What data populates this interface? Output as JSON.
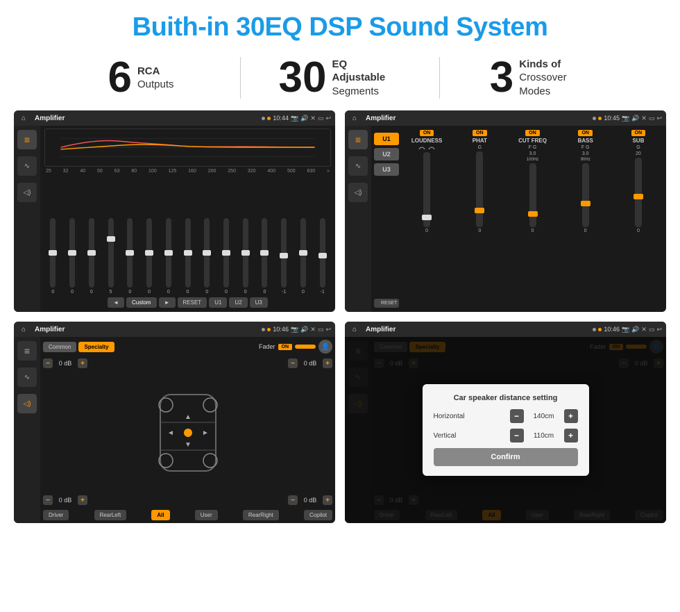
{
  "page": {
    "title": "Buith-in 30EQ DSP Sound System"
  },
  "stats": [
    {
      "number": "6",
      "label_main": "RCA",
      "label_sub": "Outputs"
    },
    {
      "number": "30",
      "label_main": "EQ Adjustable",
      "label_sub": "Segments"
    },
    {
      "number": "3",
      "label_main": "Kinds of",
      "label_sub": "Crossover Modes"
    }
  ],
  "screens": [
    {
      "id": "eq-screen",
      "time": "10:44",
      "title": "Amplifier",
      "eq_labels": [
        "25",
        "32",
        "40",
        "50",
        "63",
        "80",
        "100",
        "125",
        "160",
        "200",
        "250",
        "320",
        "400",
        "500",
        "630"
      ],
      "eq_values": [
        "0",
        "0",
        "0",
        "5",
        "0",
        "0",
        "0",
        "0",
        "0",
        "0",
        "0",
        "0",
        "-1",
        "0",
        "-1"
      ],
      "presets": [
        "Custom",
        "RESET",
        "U1",
        "U2",
        "U3"
      ]
    },
    {
      "id": "crossover-screen",
      "time": "10:45",
      "title": "Amplifier",
      "channels": [
        "U1",
        "U2",
        "U3"
      ],
      "controls": [
        "LOUDNESS",
        "PHAT",
        "CUT FREQ",
        "BASS",
        "SUB"
      ]
    },
    {
      "id": "fader-screen",
      "time": "10:46",
      "title": "Amplifier",
      "tabs": [
        "Common",
        "Specialty"
      ],
      "fader_label": "Fader",
      "buttons": [
        "Driver",
        "RearLeft",
        "All",
        "User",
        "RearRight",
        "Copilot"
      ],
      "db_values": [
        "0 dB",
        "0 dB",
        "0 dB",
        "0 dB"
      ]
    },
    {
      "id": "dialog-screen",
      "time": "10:46",
      "title": "Amplifier",
      "dialog": {
        "title": "Car speaker distance setting",
        "horizontal_label": "Horizontal",
        "horizontal_value": "140cm",
        "vertical_label": "Vertical",
        "vertical_value": "110cm",
        "confirm_label": "Confirm"
      },
      "tabs": [
        "Common",
        "Specialty"
      ],
      "buttons": [
        "Driver",
        "RearLeft",
        "All",
        "User",
        "RearRight",
        "Copilot"
      ]
    }
  ]
}
